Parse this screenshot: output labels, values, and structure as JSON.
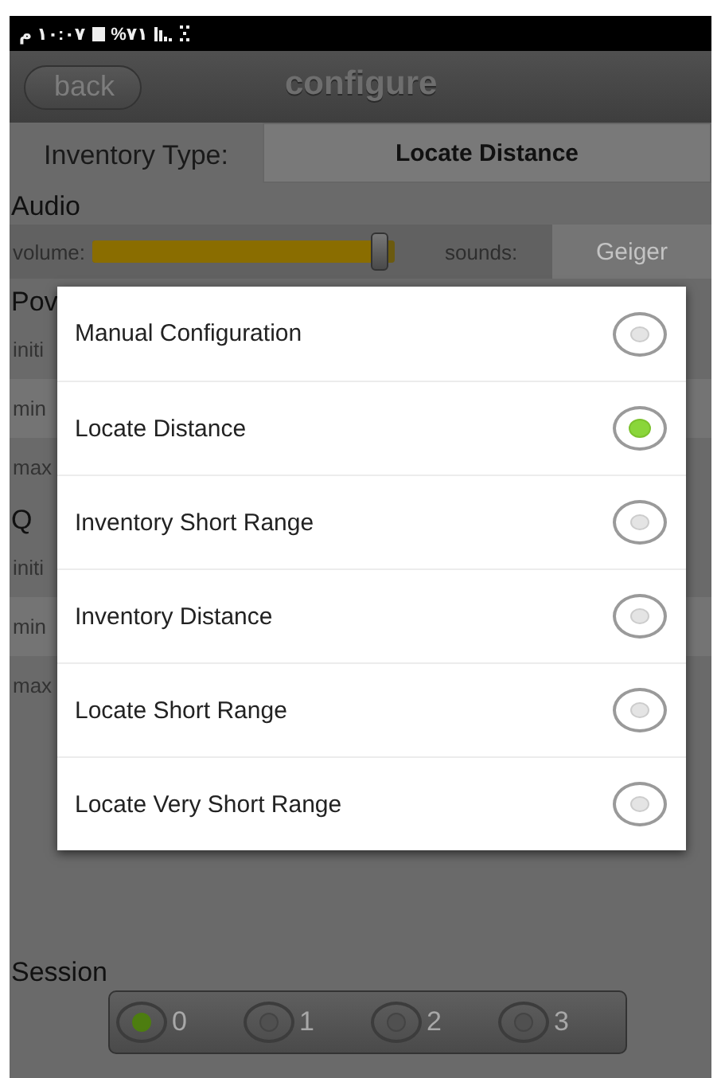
{
  "status_bar": {
    "time": "م ١٠:٠٧",
    "battery": "%٧١"
  },
  "header": {
    "back_button": "back",
    "title": "configure"
  },
  "inventory_type": {
    "label": "Inventory Type:",
    "value": "Locate Distance"
  },
  "audio": {
    "heading": "Audio",
    "volume_label": "volume:",
    "volume": {
      "level": 0.95
    },
    "sounds_label": "sounds:",
    "sounds_value": "Geiger"
  },
  "background_sections": [
    {
      "heading": "Pov",
      "rows": [
        "initi",
        "min",
        "max"
      ]
    },
    {
      "heading": "Q",
      "rows": [
        "initi",
        "min",
        "max"
      ]
    }
  ],
  "session": {
    "heading": "Session",
    "options": [
      {
        "label": "0",
        "selected": true
      },
      {
        "label": "1",
        "selected": false
      },
      {
        "label": "2",
        "selected": false
      },
      {
        "label": "3",
        "selected": false
      }
    ]
  },
  "dialog": {
    "options": [
      {
        "label": "Manual Configuration",
        "selected": false
      },
      {
        "label": "Locate Distance",
        "selected": true
      },
      {
        "label": "Inventory Short Range",
        "selected": false
      },
      {
        "label": "Inventory Distance",
        "selected": false
      },
      {
        "label": "Locate Short Range",
        "selected": false
      },
      {
        "label": "Locate Very Short Range",
        "selected": false
      }
    ]
  }
}
